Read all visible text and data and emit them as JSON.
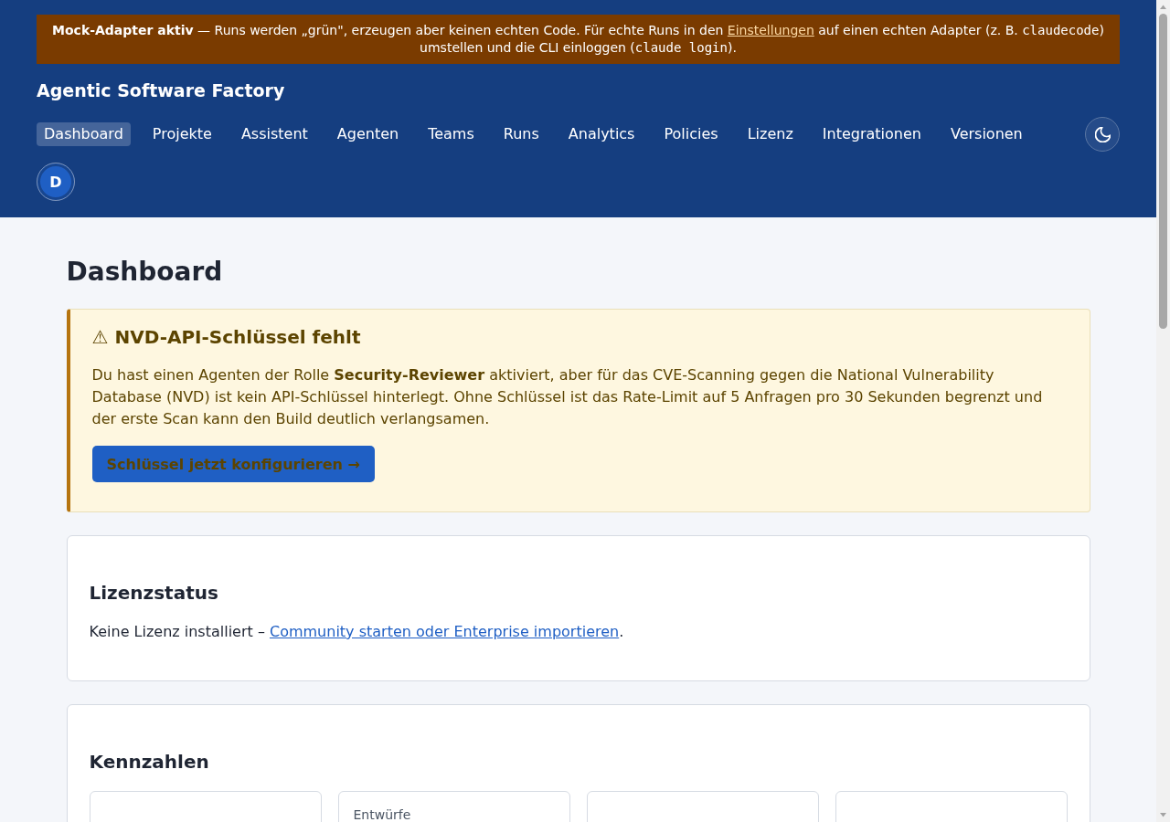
{
  "mock_banner": {
    "segments": [
      {
        "kind": "text",
        "text": "**Mock-Adapter aktiv** — Runs werden „grün\", erzeugen aber keinen echten Code. Für echte Runs in den "
      },
      {
        "kind": "link",
        "text": "Einstellungen"
      },
      {
        "kind": "text",
        "text": " auf einen echten Adapter (z. B. "
      },
      {
        "kind": "code",
        "text": "claudecode"
      },
      {
        "kind": "text",
        "text": ") umstellen und die CLI einloggen ("
      },
      {
        "kind": "code",
        "text": "claude login"
      },
      {
        "kind": "text",
        "text": ")."
      }
    ]
  },
  "header": {
    "title": "Agentic Software Factory",
    "nav": [
      {
        "label": "Dashboard",
        "selected": true
      },
      {
        "label": "Projekte",
        "selected": false
      },
      {
        "label": "Assistent",
        "selected": false
      },
      {
        "label": "Agenten",
        "selected": false
      },
      {
        "label": "Teams",
        "selected": false
      },
      {
        "label": "Runs",
        "selected": false
      },
      {
        "label": "Analytics",
        "selected": false
      },
      {
        "label": "Policies",
        "selected": false
      },
      {
        "label": "Lizenz",
        "selected": false
      },
      {
        "label": "Integrationen",
        "selected": false
      },
      {
        "label": "Versionen",
        "selected": false
      }
    ],
    "avatar": {
      "initial": "D"
    }
  },
  "page_title": "Dashboard",
  "nvd_warning": {
    "icon": "⚠",
    "title": "NVD-API-Schlüssel fehlt",
    "text": "Du hast einen Agenten der Rolle **Security-Reviewer** aktiviert, aber für das CVE-Scanning gegen die National Vulnerability Database (NVD) ist kein API-Schlüssel hinterlegt. Ohne Schlüssel ist das Rate-Limit auf 5 Anfragen pro 30 Sekunden begrenzt und der erste Scan kann den Build deutlich verlangsamen.",
    "button": "Schlüssel jetzt konfigurieren →"
  },
  "license": {
    "title": "Lizenzstatus",
    "segments": [
      {
        "kind": "text",
        "text": "Keine Lizenz installiert – "
      },
      {
        "kind": "link",
        "text": "Community starten oder Enterprise importieren"
      },
      {
        "kind": "text",
        "text": "."
      }
    ]
  },
  "metrics": {
    "title": "Kennzahlen",
    "cards": [
      {
        "kind": "blank"
      },
      {
        "kind": "labeled",
        "label": "Entwürfe"
      },
      {
        "kind": "blank"
      },
      {
        "kind": "blank"
      }
    ]
  }
}
